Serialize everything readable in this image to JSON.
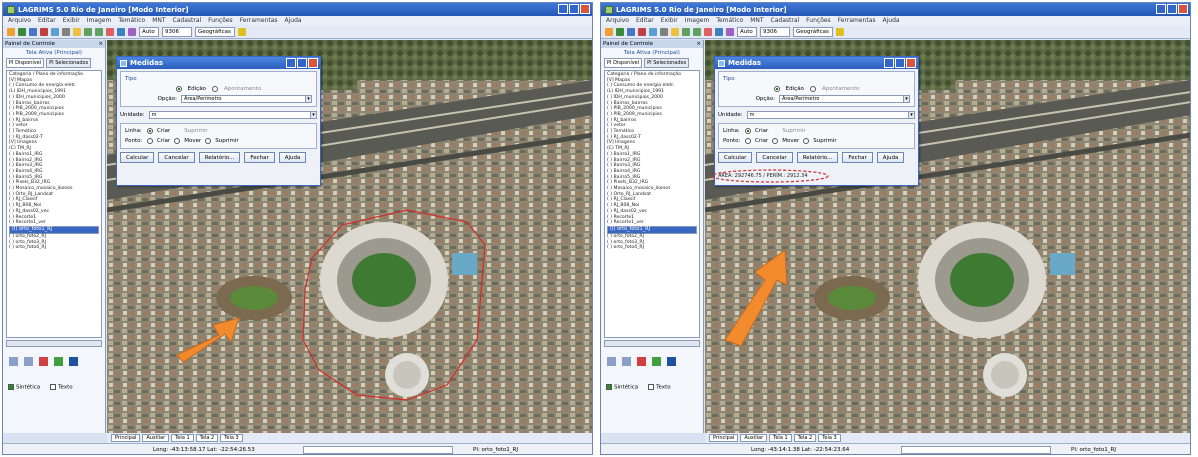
{
  "app": {
    "title_left": "LAGRIMS 5.0 Rio de Janeiro [Modo Interior]",
    "title_right": "LAGRIMS 5.0 Rio de Janeiro [Modo Interior]",
    "menus": [
      "Arquivo",
      "Editar",
      "Exibir",
      "Imagem",
      "Temático",
      "MNT",
      "Cadastral",
      "Funções",
      "Ferramentas",
      "Ajuda"
    ]
  },
  "toolbar": {
    "zoom_value": "Auto",
    "scale_value": "9306",
    "projection_value": "Geográficas"
  },
  "panel": {
    "title": "Painel de Controle",
    "view_label": "Tela Ativa (Principal)",
    "tabs": [
      "PI Disponível",
      "PI Selecionados"
    ],
    "tree_header": "Categoria / Plano de informação",
    "tree_items": [
      "[V] Mapas",
      "( ) Consumo de energia eletr.",
      "(L) IDH_municipios_1991",
      "( ) IDH_municipios_2000",
      "( ) Bairros_bairros",
      "( ) PIB_2000_municipios",
      "( ) PIB_2009_municipios",
      "( ) RJ_bairros",
      "( ) vetor",
      "[ ] Temático",
      "( ) RJ_dass02-T",
      "[V] Imagens",
      "(C) TM_RJ",
      "( ) Bairro1_IRG",
      "( ) Bairro2_IRG",
      "( ) Bairro3_IRG",
      "( ) Bairro4_IRG",
      "( ) Bairro5_IRG",
      "( ) Pixels_B32_IRG",
      "( ) Mosaico_mosaico_ikonos",
      "( ) Orto_RJ_Landsat",
      "( ) RJ_Classif",
      "( ) RJ_B08_Noi",
      "( ) RJ_dass02_vec",
      "( ) Recorte1",
      "( ) Recorte1_ver",
      "(I) orto_foto1_RJ",
      "( ) orto_foto2_RJ",
      "( ) orto_foto3_RJ",
      "( ) orto_foto4_RJ"
    ],
    "selected_index": 26,
    "checkbox_left": "Sintética",
    "checkbox_right": "Texto"
  },
  "dialog": {
    "title": "Medidas",
    "group_tipo": "Tipo",
    "radio_edicao": "Edição",
    "radio_apontamento": "Apontamento",
    "opcao_label": "Opção:",
    "opcao_value": "Área/Perímetro",
    "unidade_label": "Unidade:",
    "unidade_value": "m",
    "linha_label": "Linha:",
    "linha_criar": "Criar",
    "linha_suprimir": "Suprimir",
    "ponto_label": "Ponto:",
    "ponto_criar": "Criar",
    "ponto_mover": "Mover",
    "ponto_suprimir": "Suprimir",
    "buttons": [
      "Calcular",
      "Cancelar",
      "Relatório...",
      "Fechar",
      "Ajuda"
    ],
    "result_text": "ÁREA: 292746.75 / PERÍM.: 2912.34"
  },
  "tabs": [
    "Principal",
    "Auxiliar",
    "Tela 1",
    "Tela 2",
    "Tela 3"
  ],
  "status": {
    "left": {
      "coords": "Long: -43:13:58.17 Lat: -22:54:26.53",
      "layer": "PI: orto_foto1_RJ"
    },
    "right": {
      "coords": "Long: -43:14:1.38 Lat: -22:54:23.64",
      "layer": "PI: orto_foto1_RJ"
    }
  },
  "colors": {
    "title_blue": "#2457b5",
    "annotation_red": "#d42b2b",
    "arrow_orange": "#f28a2e"
  }
}
